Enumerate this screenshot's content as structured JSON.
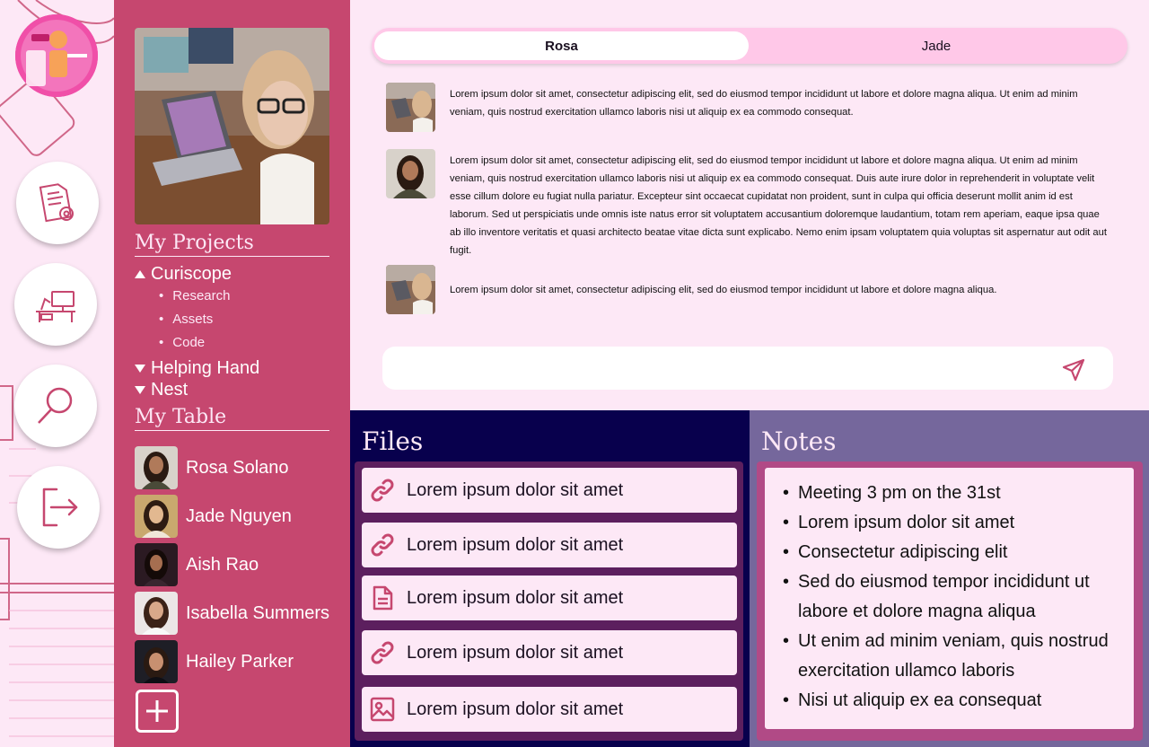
{
  "colors": {
    "sidebar": "#c6476f",
    "background": "#fde8f6",
    "files_panel": "#08004d",
    "notes_panel": "#75679c",
    "accent": "#c6476f"
  },
  "rail": {
    "buttons": [
      {
        "icon": "document-settings-icon"
      },
      {
        "icon": "desk-workspace-icon"
      },
      {
        "icon": "search-icon"
      },
      {
        "icon": "logout-icon"
      }
    ]
  },
  "sidebar": {
    "projects_title": "My Projects",
    "projects": [
      {
        "name": "Curiscope",
        "expanded": true,
        "children": [
          "Research",
          "Assets",
          "Code"
        ]
      },
      {
        "name": "Helping Hand",
        "expanded": false
      },
      {
        "name": "Nest",
        "expanded": false
      }
    ],
    "table_title": "My Table",
    "members": [
      {
        "name": "Rosa Solano"
      },
      {
        "name": "Jade Nguyen"
      },
      {
        "name": "Aish Rao"
      },
      {
        "name": "Isabella Summers"
      },
      {
        "name": "Hailey Parker"
      }
    ]
  },
  "chat": {
    "tabs": [
      {
        "label": "Rosa",
        "active": true
      },
      {
        "label": "Jade",
        "active": false
      }
    ],
    "messages": [
      {
        "text": "Lorem ipsum dolor sit amet, consectetur adipiscing elit, sed do eiusmod tempor incididunt ut labore et dolore magna aliqua. Ut enim ad minim veniam, quis nostrud exercitation ullamco laboris nisi ut aliquip ex ea commodo consequat."
      },
      {
        "text": "Lorem ipsum dolor sit amet, consectetur adipiscing elit, sed do eiusmod tempor incididunt ut labore et dolore magna aliqua. Ut enim ad minim veniam, quis nostrud exercitation ullamco laboris nisi ut aliquip ex ea commodo consequat. Duis aute irure dolor in reprehenderit in voluptate velit esse cillum dolore eu fugiat nulla pariatur. Excepteur sint occaecat cupidatat non proident, sunt in culpa qui officia deserunt mollit anim id est laborum. Sed ut perspiciatis unde omnis iste natus error sit voluptatem accusantium doloremque laudantium, totam rem aperiam, eaque ipsa quae ab illo inventore veritatis et quasi architecto beatae vitae dicta sunt explicabo. Nemo enim ipsam voluptatem quia voluptas sit aspernatur aut odit aut fugit."
      },
      {
        "text": "Lorem ipsum dolor sit amet, consectetur adipiscing elit, sed do eiusmod tempor incididunt ut labore et dolore magna aliqua."
      }
    ],
    "input_value": "",
    "send_icon": "send-icon"
  },
  "files": {
    "title": "Files",
    "items": [
      {
        "label": "Lorem ipsum dolor sit amet",
        "icon": "link-icon"
      },
      {
        "label": "Lorem ipsum dolor sit amet",
        "icon": "link-icon"
      },
      {
        "label": "Lorem ipsum dolor sit amet",
        "icon": "document-icon"
      },
      {
        "label": "Lorem ipsum dolor sit amet",
        "icon": "link-icon"
      },
      {
        "label": "Lorem ipsum dolor sit amet",
        "icon": "image-icon"
      }
    ]
  },
  "notes": {
    "title": "Notes",
    "items": [
      "Meeting 3 pm on the 31st",
      "Lorem ipsum dolor sit amet",
      "Consectetur adipiscing elit",
      "Sed do eiusmod tempor incididunt ut labore et dolore magna aliqua",
      "Ut enim ad minim veniam, quis nostrud exercitation ullamco laboris",
      "Nisi ut aliquip ex ea consequat"
    ]
  }
}
